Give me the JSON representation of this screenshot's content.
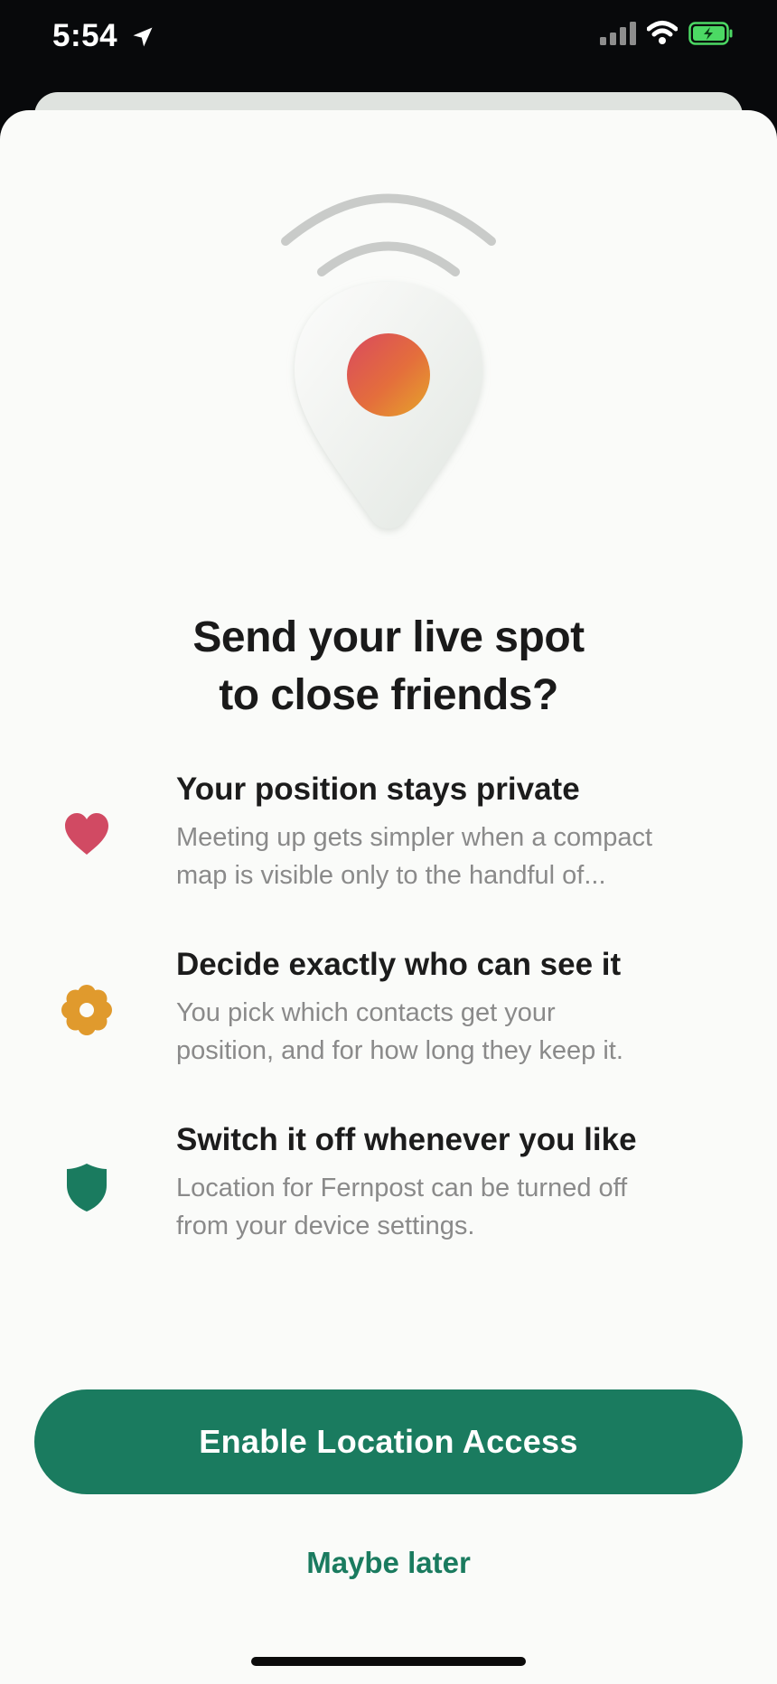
{
  "status_bar": {
    "time": "5:54",
    "icons": [
      "location-arrow-icon",
      "cellular-signal-icon",
      "wifi-icon",
      "battery-charging-icon"
    ]
  },
  "hero": {
    "icon": "location-pin-broadcast-icon"
  },
  "headline": {
    "line1": "Send your live spot",
    "line2": "to close friends?"
  },
  "features": [
    {
      "icon": "heart-icon",
      "icon_color": "#d14a63",
      "title": "Your position stays private",
      "description_line1": "Meeting up gets simpler when a compact",
      "description_line2": "map is visible only to the handful of..."
    },
    {
      "icon": "flower-badge-icon",
      "icon_color": "#e09a2d",
      "title": "Decide exactly who can see it",
      "description_line1": "You pick which contacts get your",
      "description_line2": "position, and for how long they keep it."
    },
    {
      "icon": "shield-icon",
      "icon_color": "#1a7b5f",
      "title": "Switch it off whenever you like",
      "description_line1": "Location for Fernpost can be turned off",
      "description_line2": "from your device settings."
    }
  ],
  "actions": {
    "primary_label": "Enable Location Access",
    "secondary_label": "Maybe later"
  },
  "colors": {
    "accent": "#1a7b5f",
    "sheet_background": "#fafbf9",
    "status_background": "#08090b"
  }
}
